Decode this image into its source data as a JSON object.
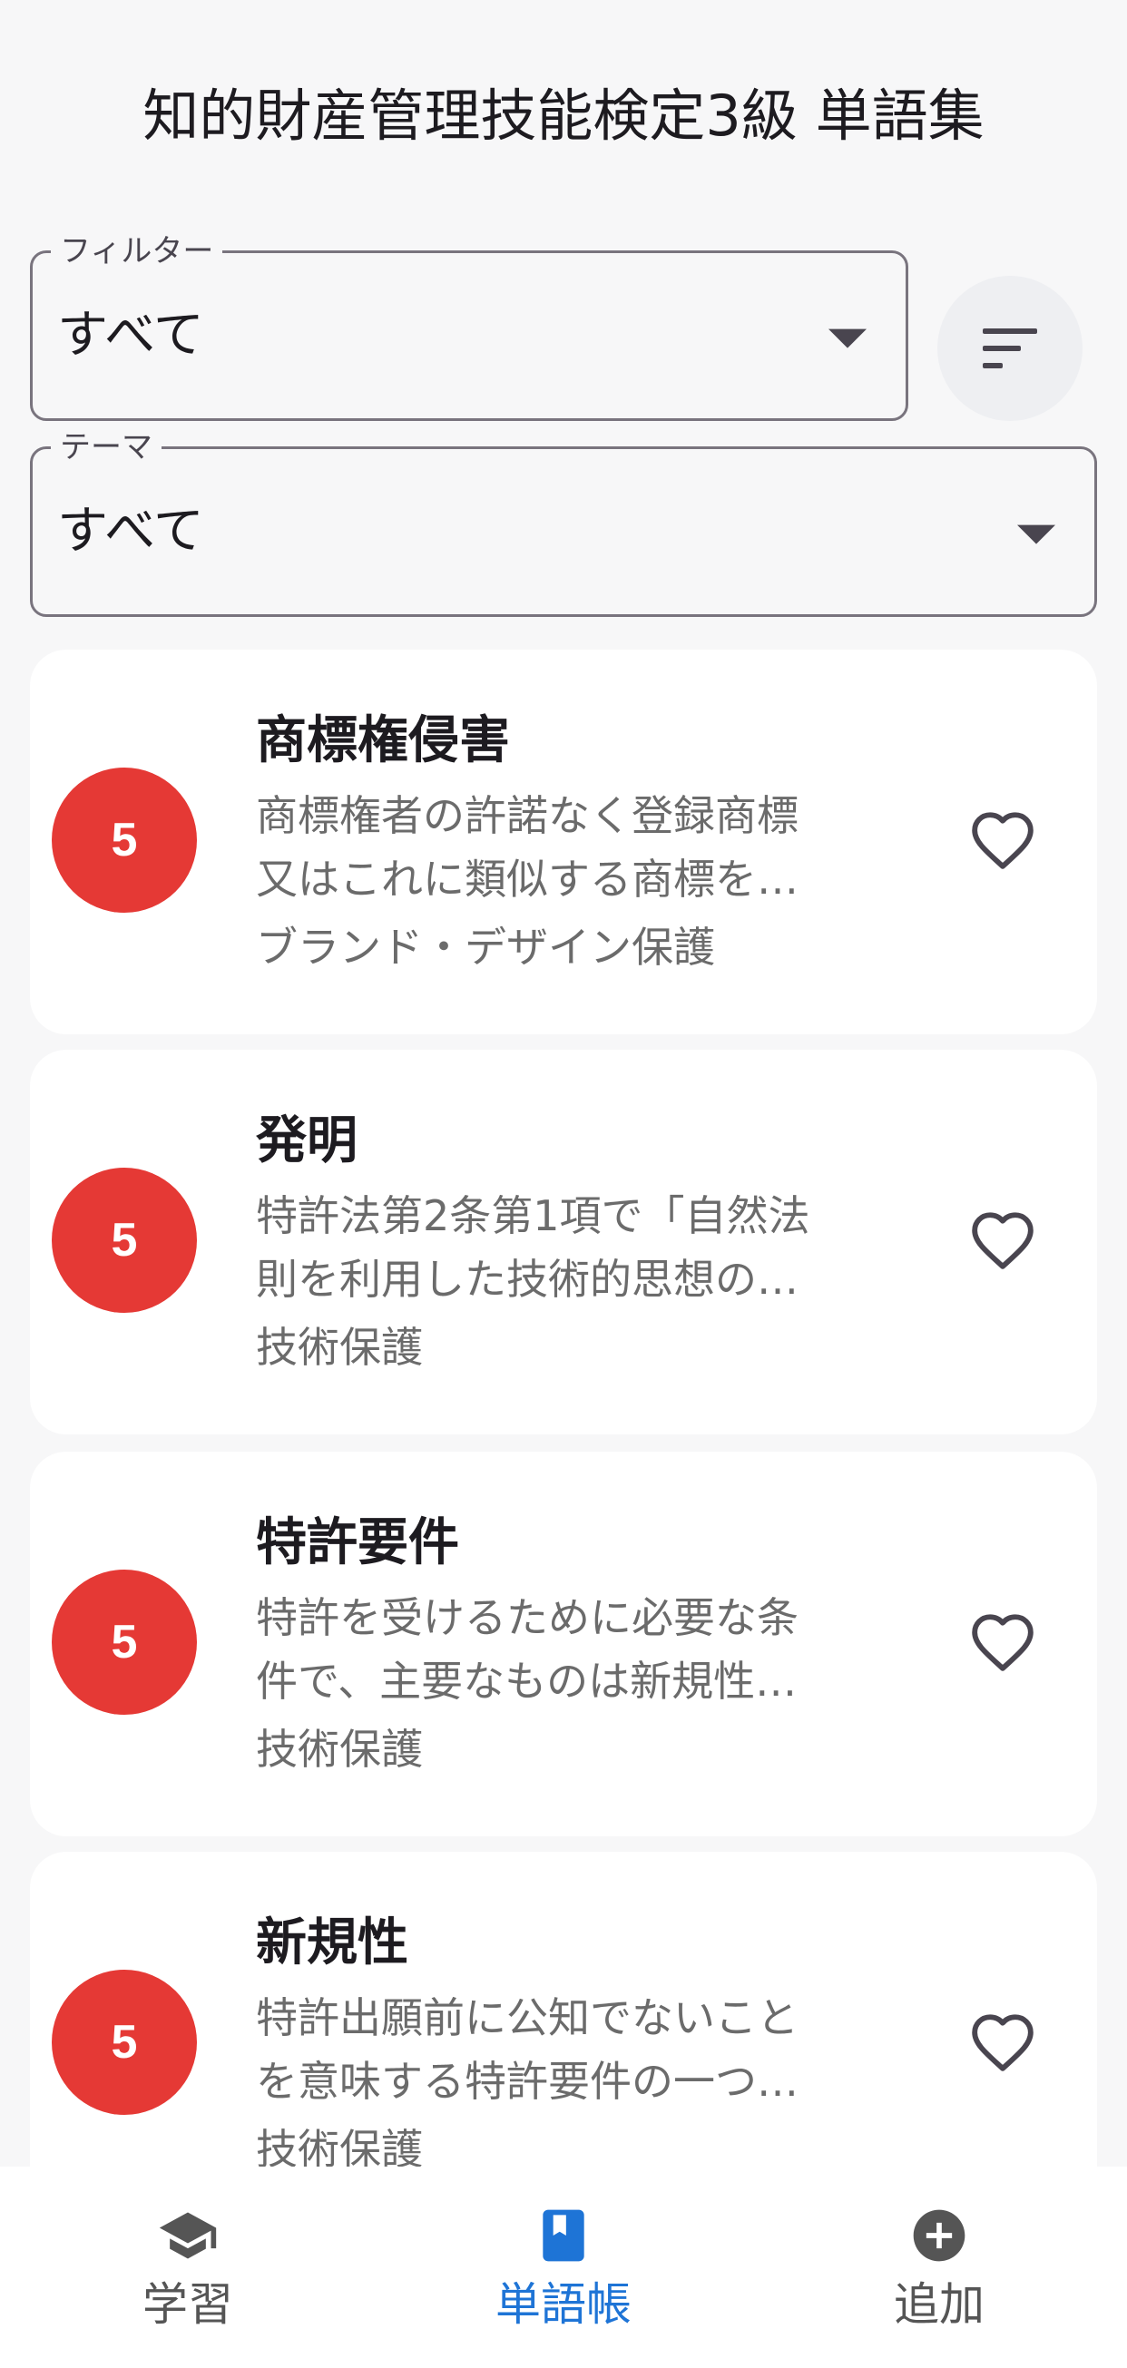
{
  "header": {
    "title": "知的財産管理技能検定3級 単語集"
  },
  "filters": {
    "filter": {
      "label": "フィルター",
      "value": "すべて"
    },
    "theme": {
      "label": "テーマ",
      "value": "すべて"
    }
  },
  "words": [
    {
      "level": "5",
      "term": "商標権侵害",
      "definition_lines": [
        "商標権者の許諾なく登録商標",
        "又はこれに類似する商標を…"
      ],
      "theme": "ブランド・デザイン保護",
      "favorite": false
    },
    {
      "level": "5",
      "term": "発明",
      "definition_lines": [
        "特許法第2条第1項で「自然法",
        "則を利用した技術的思想の…"
      ],
      "theme": "技術保護",
      "favorite": false
    },
    {
      "level": "5",
      "term": "特許要件",
      "definition_lines": [
        "特許を受けるために必要な条",
        "件で、主要なものは新規性…"
      ],
      "theme": "技術保護",
      "favorite": false
    },
    {
      "level": "5",
      "term": "新規性",
      "definition_lines": [
        "特許出願前に公知でないこと",
        "を意味する特許要件の一つ…"
      ],
      "theme": "技術保護",
      "favorite": false
    }
  ],
  "nav": {
    "items": [
      {
        "label": "学習",
        "icon": "graduation-cap-icon",
        "active": false
      },
      {
        "label": "単語帳",
        "icon": "book-icon",
        "active": true
      },
      {
        "label": "追加",
        "icon": "add-circle-icon",
        "active": false
      }
    ]
  },
  "colors": {
    "level_badge": "#e53935",
    "active_nav": "#1e74d6",
    "inactive_nav": "#555555"
  }
}
